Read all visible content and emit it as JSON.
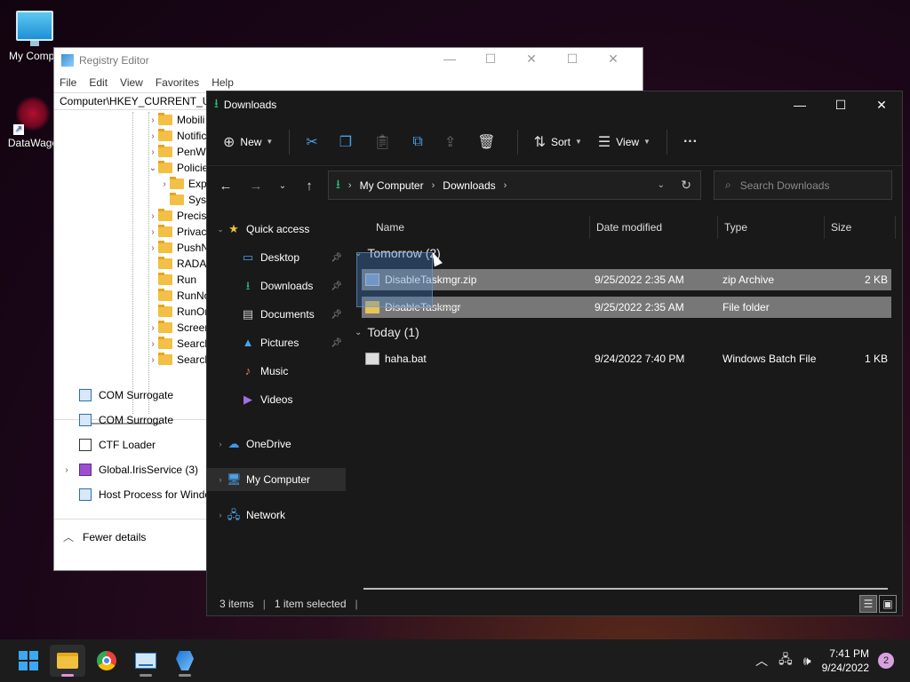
{
  "desktop": {
    "icons": [
      {
        "label": "My Compu"
      },
      {
        "label": "DataWago"
      }
    ]
  },
  "regedit": {
    "title": "Registry Editor",
    "menu": [
      "File",
      "Edit",
      "View",
      "Favorites",
      "Help"
    ],
    "address": "Computer\\HKEY_CURRENT_USE",
    "tree": [
      "Mobili",
      "Notific",
      "PenWo",
      "Policie",
      "Exp",
      "Sys",
      "Precisi",
      "Privacy",
      "PushN",
      "RADAR",
      "Run",
      "RunNo",
      "RunOn",
      "Screen",
      "Search",
      "Search"
    ]
  },
  "taskmgr": {
    "processes": [
      "COM Surrogate",
      "COM Surrogate",
      "CTF Loader",
      "Global.IrisService (3)",
      "Host Process for Windo"
    ],
    "fewer_details": "Fewer details"
  },
  "explorer": {
    "title": "Downloads",
    "toolbar": {
      "new": "New",
      "sort": "Sort",
      "view": "View",
      "more": "···"
    },
    "breadcrumb": [
      "My Computer",
      "Downloads"
    ],
    "search_placeholder": "Search Downloads",
    "sidebar": {
      "quick_access": "Quick access",
      "items": [
        "Desktop",
        "Downloads",
        "Documents",
        "Pictures",
        "Music",
        "Videos"
      ],
      "onedrive": "OneDrive",
      "my_computer": "My Computer",
      "network": "Network"
    },
    "columns": {
      "name": "Name",
      "date": "Date modified",
      "type": "Type",
      "size": "Size"
    },
    "groups": [
      {
        "label": "Tomorrow (2)",
        "files": [
          {
            "name": "DisableTaskmgr.zip",
            "date": "9/25/2022 2:35 AM",
            "type": "zip Archive",
            "size": "2 KB"
          },
          {
            "name": "DisableTaskmgr",
            "date": "9/25/2022 2:35 AM",
            "type": "File folder",
            "size": ""
          }
        ]
      },
      {
        "label": "Today (1)",
        "files": [
          {
            "name": "haha.bat",
            "date": "9/24/2022 7:40 PM",
            "type": "Windows Batch File",
            "size": "1 KB"
          }
        ]
      }
    ],
    "status": {
      "count": "3 items",
      "selected": "1 item selected"
    }
  },
  "taskbar": {
    "time": "7:41 PM",
    "date": "9/24/2022",
    "notifications": "2"
  },
  "colors": {
    "accent_green": "#2ec27e",
    "explorer_bg": "#191919",
    "selection": "#777777"
  }
}
